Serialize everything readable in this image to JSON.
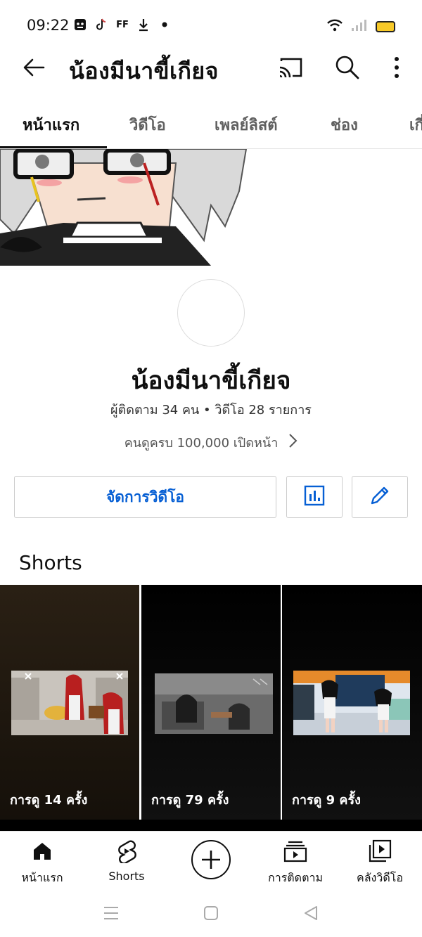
{
  "status_bar": {
    "time": "09:22",
    "notification_icons": [
      "shield-face-icon",
      "tiktok-icon",
      "ff-icon",
      "download-icon",
      "dot-icon"
    ],
    "ff_text": "FF",
    "right_icons": [
      "wifi-icon",
      "signal-icon",
      "battery-icon"
    ]
  },
  "app_bar": {
    "title": "น้องมีนาขี้เกียจ",
    "icons": [
      "back-arrow-icon",
      "cast-icon",
      "search-icon",
      "more-vert-icon"
    ]
  },
  "tabs": [
    {
      "label": "หน้าแรก",
      "active": true
    },
    {
      "label": "วิดีโอ",
      "active": false
    },
    {
      "label": "เพลย์ลิสต์",
      "active": false
    },
    {
      "label": "ช่อง",
      "active": false
    },
    {
      "label": "เกี่ยวกับ",
      "active": false
    }
  ],
  "channel": {
    "name": "น้องมีนาขี้เกียจ",
    "stats": "ผู้ติดตาม 34 คน • วิดีโอ 28 รายการ",
    "views_text": "คนดูครบ 100,000 เปิดหน้า"
  },
  "actions": {
    "manage_label": "จัดการวิดีโอ",
    "analytics_icon": "analytics-icon",
    "edit_icon": "pencil-icon"
  },
  "shorts": {
    "title": "Shorts",
    "items": [
      {
        "views": "การดู 14 ครั้ง"
      },
      {
        "views": "การดู 79 ครั้ง"
      },
      {
        "views": "การดู 9 ครั้ง"
      }
    ]
  },
  "bottom_nav": {
    "items": [
      {
        "label": "หน้าแรก",
        "icon": "home-icon"
      },
      {
        "label": "Shorts",
        "icon": "shorts-icon"
      },
      {
        "label": "",
        "icon": "create-plus-icon"
      },
      {
        "label": "การติดตาม",
        "icon": "subscriptions-icon"
      },
      {
        "label": "คลังวิดีโอ",
        "icon": "library-icon"
      }
    ]
  },
  "colors": {
    "accent_blue": "#065fd4",
    "text_primary": "#0f0f0f",
    "text_secondary": "#606060",
    "battery_yellow": "#f7c928"
  }
}
